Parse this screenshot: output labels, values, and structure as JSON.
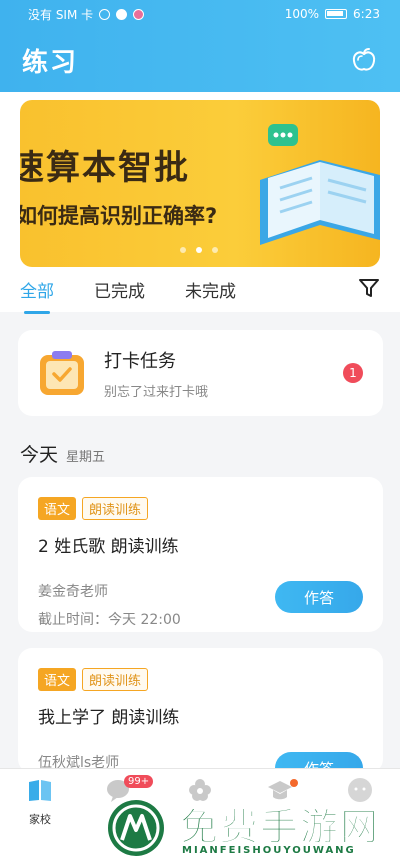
{
  "status_bar": {
    "carrier": "没有 SIM 卡",
    "battery": "100%",
    "time": "6:23"
  },
  "header": {
    "title": "练习",
    "icon": "apple-icon"
  },
  "banner": {
    "line1": "速算本智批",
    "line2": "如何提高识别正确率?",
    "dots": 3,
    "active_dot": 1
  },
  "tabs": [
    {
      "label": "全部",
      "active": true
    },
    {
      "label": "已完成",
      "active": false
    },
    {
      "label": "未完成",
      "active": false
    }
  ],
  "task_card": {
    "title": "打卡任务",
    "subtitle": "别忘了过来打卡哦",
    "badge": "1"
  },
  "date": {
    "main": "今天",
    "weekday": "星期五"
  },
  "homework": [
    {
      "subject": "语文",
      "type": "朗读训练",
      "title": "2 姓氏歌 朗读训练",
      "teacher": "姜金奇老师",
      "deadline": "截止时间：今天 22:00",
      "button": "作答"
    },
    {
      "subject": "语文",
      "type": "朗读训练",
      "title": "我上学了 朗读训练",
      "teacher": "伍秋斌ls老师",
      "button": "作答"
    }
  ],
  "bottom_nav": {
    "home_label": "家校",
    "message_badge": "99+"
  },
  "watermark": {
    "text": "免费手游网",
    "sub": "MIANFEISHOUYOUWANG"
  },
  "colors": {
    "primary": "#3fb2ee",
    "accent_orange": "#f5a623",
    "badge_red": "#f04c5a",
    "banner_yellow": "#f9c12e"
  }
}
